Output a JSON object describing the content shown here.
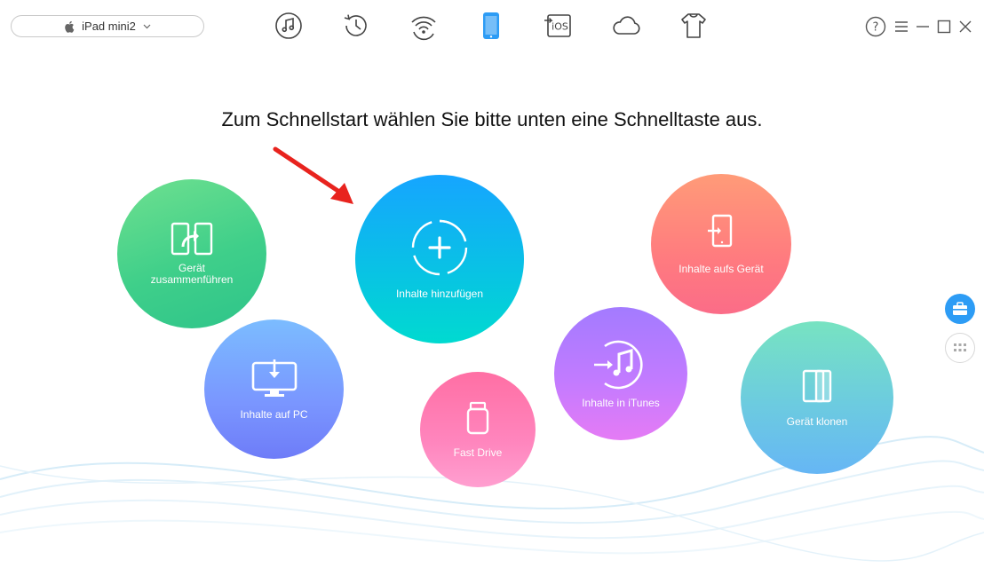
{
  "device": {
    "name": "iPad mini2"
  },
  "nav": {
    "items": [
      {
        "id": "music",
        "icon": "music-note-icon"
      },
      {
        "id": "history",
        "icon": "clock-history-icon"
      },
      {
        "id": "wifi",
        "icon": "wifi-refresh-icon"
      },
      {
        "id": "device",
        "icon": "ipad-device-icon",
        "active": true
      },
      {
        "id": "ios",
        "icon": "ios-update-icon",
        "label": "iOS"
      },
      {
        "id": "cloud",
        "icon": "icloud-icon"
      },
      {
        "id": "toolkit",
        "icon": "shirt-icon"
      }
    ],
    "active_color": "#2d9cf5",
    "icon_color": "#444444"
  },
  "window": {
    "help_label": "?"
  },
  "headline": "Zum Schnellstart wählen Sie bitte unten eine Schnelltaste aus.",
  "quick_actions": {
    "merge": {
      "label_line1": "Gerät",
      "label_line2": "zusammenführen",
      "icon": "device-merge-icon"
    },
    "add": {
      "label": "Inhalte hinzufügen",
      "icon": "add-plus-icon"
    },
    "to_device": {
      "label": "Inhalte aufs Gerät",
      "icon": "to-device-icon"
    },
    "to_pc": {
      "label": "Inhalte auf PC",
      "icon": "monitor-download-icon"
    },
    "fast_drive": {
      "label": "Fast Drive",
      "icon": "usb-drive-icon"
    },
    "to_itunes": {
      "label": "Inhalte in iTunes",
      "icon": "itunes-import-icon"
    },
    "clone": {
      "label": "Gerät klonen",
      "icon": "device-clone-icon"
    }
  },
  "colors": {
    "arrow": "#e8231e",
    "side_active": "#2d9cf5"
  }
}
